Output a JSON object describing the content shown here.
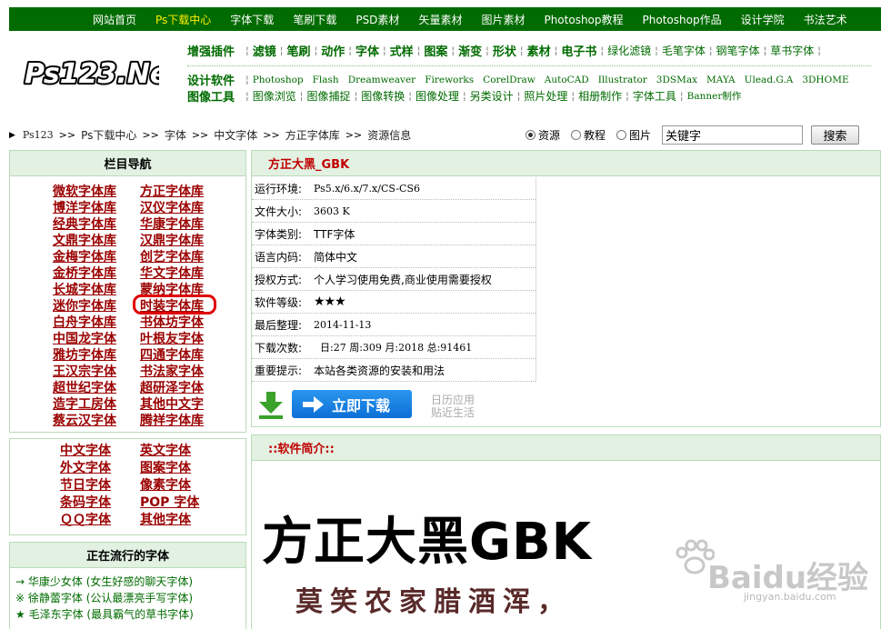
{
  "topnav": [
    "网站首页",
    "Ps下载中心",
    "字体下载",
    "笔刷下载",
    "PSD素材",
    "矢量素材",
    "图片素材",
    "Photoshop教程",
    "Photoshop作品",
    "设计学院",
    "书法艺术"
  ],
  "logo_text": "Ps123.Net",
  "header": {
    "row1_label": "增强插件",
    "row1_items": [
      "滤镜",
      "笔刷",
      "动作",
      "字体",
      "式样",
      "图案",
      "渐变",
      "形状",
      "素材",
      "电子书"
    ],
    "row1_extra": [
      "绿化滤镜",
      "毛笔字体",
      "钢笔字体",
      "草书字体"
    ],
    "row2_label": "设计软件",
    "row2_items": [
      "Photoshop",
      "Flash",
      "Dreamweaver",
      "Fireworks",
      "CorelDraw",
      "AutoCAD",
      "Illustrator",
      "3DSMax",
      "MAYA",
      "Ulead.G.A",
      "3DHOME"
    ],
    "row3_label": "图像工具",
    "row3_items": [
      "图像浏览",
      "图像捕捉",
      "图像转换",
      "图像处理",
      "另类设计",
      "照片处理",
      "相册制作",
      "字体工具",
      "Banner制作"
    ]
  },
  "breadcrumb": [
    "Ps123",
    "Ps下载中心",
    "字体",
    "中文字体",
    "方正字体库",
    "资源信息"
  ],
  "search": {
    "options": [
      "资源",
      "教程",
      "图片"
    ],
    "selected": "资源",
    "keyword": "关键字",
    "button": "搜索"
  },
  "left_nav": {
    "title": "栏目导航",
    "items": [
      "微软字体库",
      "方正字体库",
      "博洋字体库",
      "汉仪字体库",
      "经典字体库",
      "华康字体库",
      "文鼎字体库",
      "汉鼎字体库",
      "金梅字体库",
      "创艺字体库",
      "金桥字体库",
      "华文字体库",
      "长城字体库",
      "蒙纳字体库",
      "迷你字体库",
      "时装字体库",
      "白舟字体库",
      "书体坊字体",
      "中国龙字体",
      "叶根友字体",
      "雅坊字体库",
      "四通字体库",
      "王汉宗字体",
      "书法家字体",
      "超世纪字体",
      "超研泽字体",
      "造字工房体",
      "其他中文字",
      "蔡云汉字体",
      "腾祥字体库"
    ]
  },
  "categories": [
    "中文字体",
    "英文字体",
    "外文字体",
    "图案字体",
    "节日字体",
    "像素字体",
    "条码字体",
    "POP 字体",
    "ＱＱ字体",
    "其他字体"
  ],
  "popular": {
    "title": "正在流行的字体",
    "items": [
      {
        "mark": "→",
        "text": "华康少女体 (女生好感的聊天字体)"
      },
      {
        "mark": "※",
        "text": "徐静蕾字体 (公认最漂亮手写字体)"
      },
      {
        "mark": "★",
        "text": "毛泽东字体 (最具霸气的草书字体)"
      }
    ]
  },
  "resource": {
    "title": "方正大黑_GBK",
    "rows": [
      {
        "k": "运行环境:",
        "v": "Ps5.x/6.x/7.x/CS-CS6"
      },
      {
        "k": "文件大小:",
        "v": "3603 K"
      },
      {
        "k": "字体类别:",
        "v": "TTF字体"
      },
      {
        "k": "语言内码:",
        "v": "简体中文"
      },
      {
        "k": "授权方式:",
        "v": "个人学习使用免费,商业使用需要授权"
      },
      {
        "k": "软件等级:",
        "v": "★★★"
      },
      {
        "k": "最后整理:",
        "v": "2014-11-13"
      },
      {
        "k": "下载次数:",
        "v": "  日:27 周:309 月:2018 总:91461"
      },
      {
        "k": "重要提示:",
        "v": "本站各类资源的安装和用法"
      }
    ],
    "download_label": "立即下载",
    "side_text": [
      "日历应用",
      "贴近生活"
    ]
  },
  "intro": {
    "title": "::软件简介::",
    "sample_title": "方正大黑GBK",
    "sample_line": "莫笑农家腊酒浑，"
  },
  "watermark": {
    "main": "Baidu经验",
    "sub": "jingyan.baidu.com"
  },
  "colors": {
    "nav_green": "#006b00",
    "panel_head": "#e2f1e2",
    "link_red": "#9b0000",
    "title_red": "#c00000",
    "button_blue": "#1a82e6",
    "highlight": "#e00000"
  }
}
